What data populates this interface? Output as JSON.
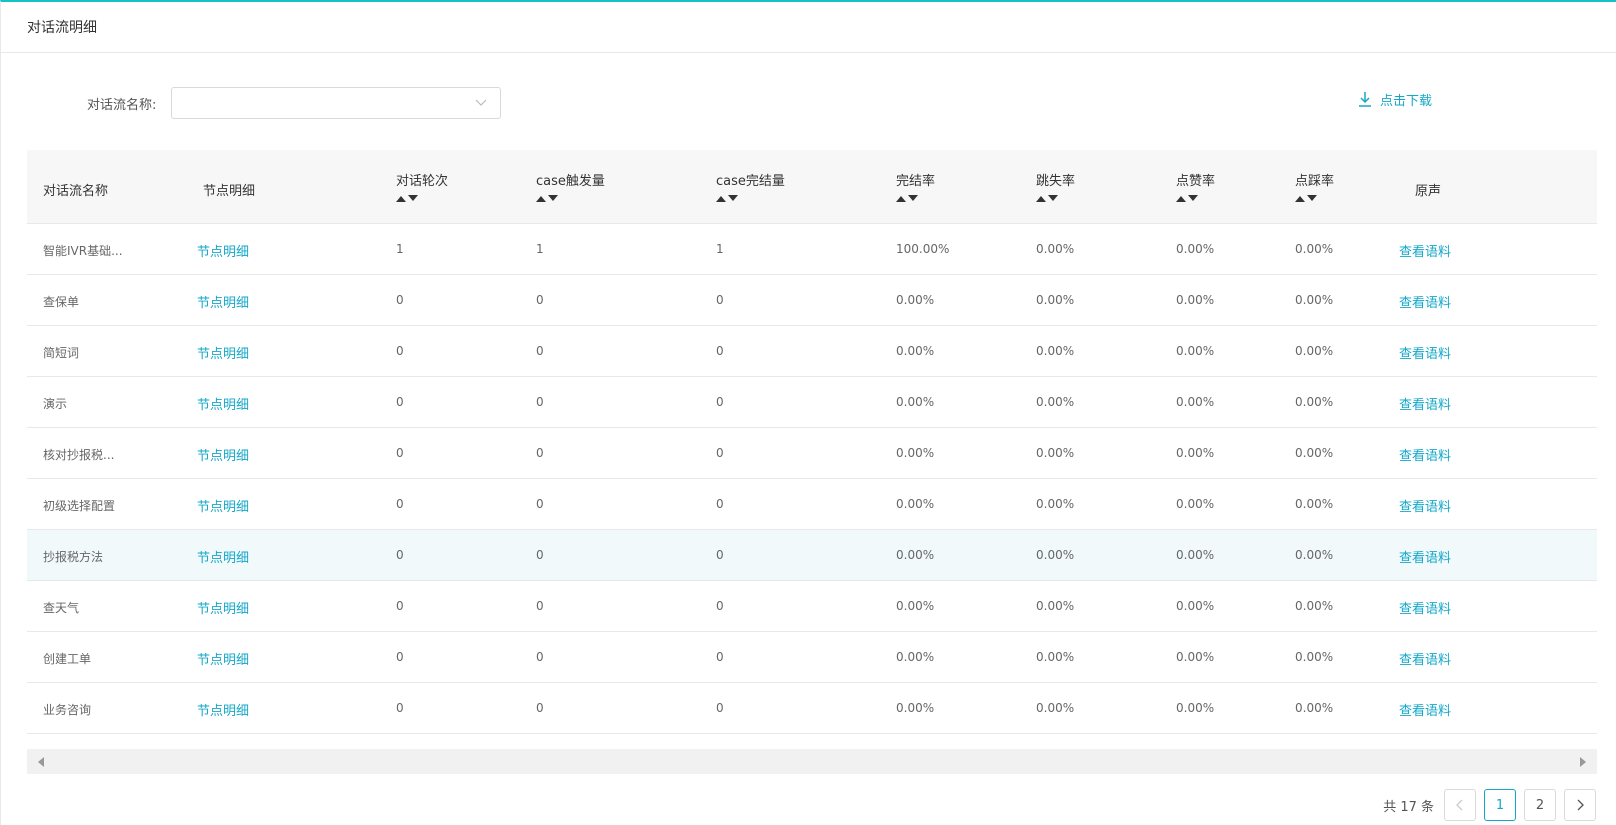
{
  "page": {
    "title": "对话流明细"
  },
  "filter": {
    "label": "对话流名称:",
    "value": "",
    "placeholder": ""
  },
  "download": {
    "label": "点击下载",
    "icon": "download-icon"
  },
  "table": {
    "columns": [
      "对话流名称",
      "节点明细",
      "对话轮次",
      "case触发量",
      "case完结量",
      "完结率",
      "跳失率",
      "点赞率",
      "点踩率",
      "原声"
    ],
    "rows": [
      {
        "name": "智能IVR基础...",
        "detail": "节点明细",
        "turns": "1",
        "trigger": "1",
        "complete": "1",
        "complete_rate": "100.00%",
        "drop_rate": "0.00%",
        "like_rate": "0.00%",
        "dislike_rate": "0.00%",
        "voice": "查看语料"
      },
      {
        "name": "查保单",
        "detail": "节点明细",
        "turns": "0",
        "trigger": "0",
        "complete": "0",
        "complete_rate": "0.00%",
        "drop_rate": "0.00%",
        "like_rate": "0.00%",
        "dislike_rate": "0.00%",
        "voice": "查看语料"
      },
      {
        "name": "简短词",
        "detail": "节点明细",
        "turns": "0",
        "trigger": "0",
        "complete": "0",
        "complete_rate": "0.00%",
        "drop_rate": "0.00%",
        "like_rate": "0.00%",
        "dislike_rate": "0.00%",
        "voice": "查看语料"
      },
      {
        "name": "演示",
        "detail": "节点明细",
        "turns": "0",
        "trigger": "0",
        "complete": "0",
        "complete_rate": "0.00%",
        "drop_rate": "0.00%",
        "like_rate": "0.00%",
        "dislike_rate": "0.00%",
        "voice": "查看语料"
      },
      {
        "name": "核对抄报税...",
        "detail": "节点明细",
        "turns": "0",
        "trigger": "0",
        "complete": "0",
        "complete_rate": "0.00%",
        "drop_rate": "0.00%",
        "like_rate": "0.00%",
        "dislike_rate": "0.00%",
        "voice": "查看语料"
      },
      {
        "name": "初级选择配置",
        "detail": "节点明细",
        "turns": "0",
        "trigger": "0",
        "complete": "0",
        "complete_rate": "0.00%",
        "drop_rate": "0.00%",
        "like_rate": "0.00%",
        "dislike_rate": "0.00%",
        "voice": "查看语料"
      },
      {
        "name": "抄报税方法",
        "detail": "节点明细",
        "turns": "0",
        "trigger": "0",
        "complete": "0",
        "complete_rate": "0.00%",
        "drop_rate": "0.00%",
        "like_rate": "0.00%",
        "dislike_rate": "0.00%",
        "voice": "查看语料"
      },
      {
        "name": "查天气",
        "detail": "节点明细",
        "turns": "0",
        "trigger": "0",
        "complete": "0",
        "complete_rate": "0.00%",
        "drop_rate": "0.00%",
        "like_rate": "0.00%",
        "dislike_rate": "0.00%",
        "voice": "查看语料"
      },
      {
        "name": "创建工单",
        "detail": "节点明细",
        "turns": "0",
        "trigger": "0",
        "complete": "0",
        "complete_rate": "0.00%",
        "drop_rate": "0.00%",
        "like_rate": "0.00%",
        "dislike_rate": "0.00%",
        "voice": "查看语料"
      },
      {
        "name": "业务咨询",
        "detail": "节点明细",
        "turns": "0",
        "trigger": "0",
        "complete": "0",
        "complete_rate": "0.00%",
        "drop_rate": "0.00%",
        "like_rate": "0.00%",
        "dislike_rate": "0.00%",
        "voice": "查看语料"
      }
    ]
  },
  "pagination": {
    "total_text": "共 17 条",
    "pages": [
      "1",
      "2"
    ],
    "current": "1"
  },
  "colors": {
    "accent": "#13a8c9",
    "top_border": "#13c2c2",
    "header_bg": "#f7f7f7",
    "row_highlight": "#f2f9fb"
  }
}
